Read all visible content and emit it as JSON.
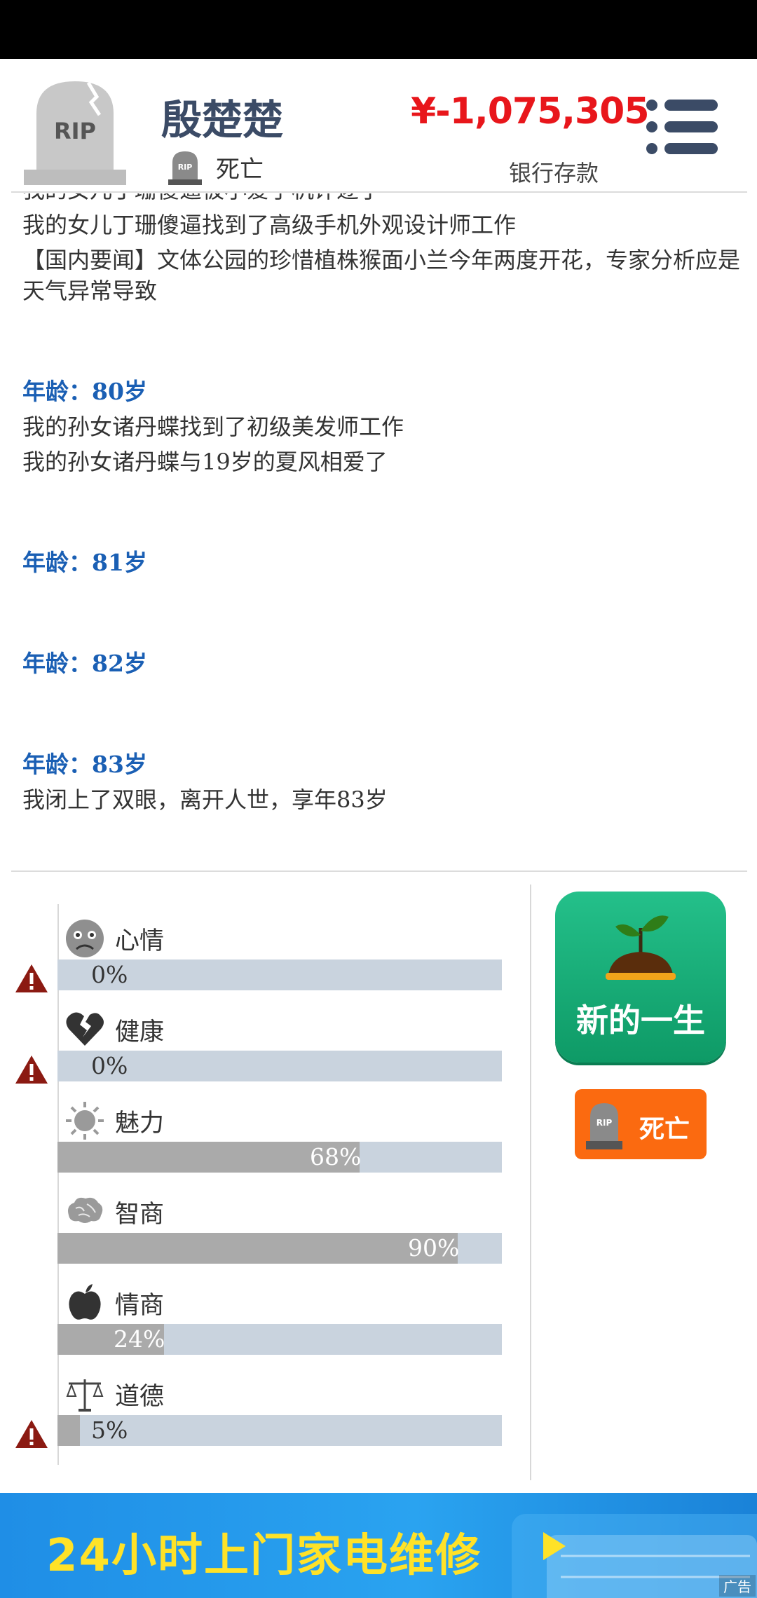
{
  "header": {
    "tomb_text": "RIP",
    "name": "殷楚楚",
    "status": "死亡",
    "money": "¥-1,075,305",
    "money_label": "银行存款"
  },
  "log": {
    "lines": [
      "我的女儿丁珊傻逼被小爱了机评逐了",
      "我的女儿丁珊傻逼找到了高级手机外观设计师工作",
      "【国内要闻】文体公园的珍惜植株猴面小兰今年两度开花，专家分析应是天气异常导致",
      "年龄：80岁",
      "我的孙女诸丹蝶找到了初级美发师工作",
      "我的孙女诸丹蝶与19岁的夏风相爱了",
      "年龄：81岁",
      "年龄：82岁",
      "年龄：83岁",
      "我闭上了双眼，离开人世，享年83岁"
    ]
  },
  "stats": [
    {
      "label": "心情",
      "icon": "sad-face-icon",
      "value": 0,
      "display": "0%",
      "warning": true
    },
    {
      "label": "健康",
      "icon": "broken-heart-icon",
      "value": 0,
      "display": "0%",
      "warning": true
    },
    {
      "label": "魅力",
      "icon": "sun-icon",
      "value": 68,
      "display": "68%",
      "warning": false
    },
    {
      "label": "智商",
      "icon": "brain-icon",
      "value": 90,
      "display": "90%",
      "warning": false
    },
    {
      "label": "情商",
      "icon": "apple-icon",
      "value": 24,
      "display": "24%",
      "warning": false
    },
    {
      "label": "道德",
      "icon": "scales-icon",
      "value": 5,
      "display": "5%",
      "warning": true
    }
  ],
  "buttons": {
    "new_life": "新的一生",
    "death_label": "死亡"
  },
  "ad": {
    "text": "24小时上门家电维修",
    "tag": "广告"
  },
  "colors": {
    "money": "#e8161b",
    "age": "#1a5fb4",
    "new_life": "#17aa74",
    "death": "#fb6a10",
    "ad_bg": "#2196f3",
    "ad_text": "#ffe228"
  }
}
